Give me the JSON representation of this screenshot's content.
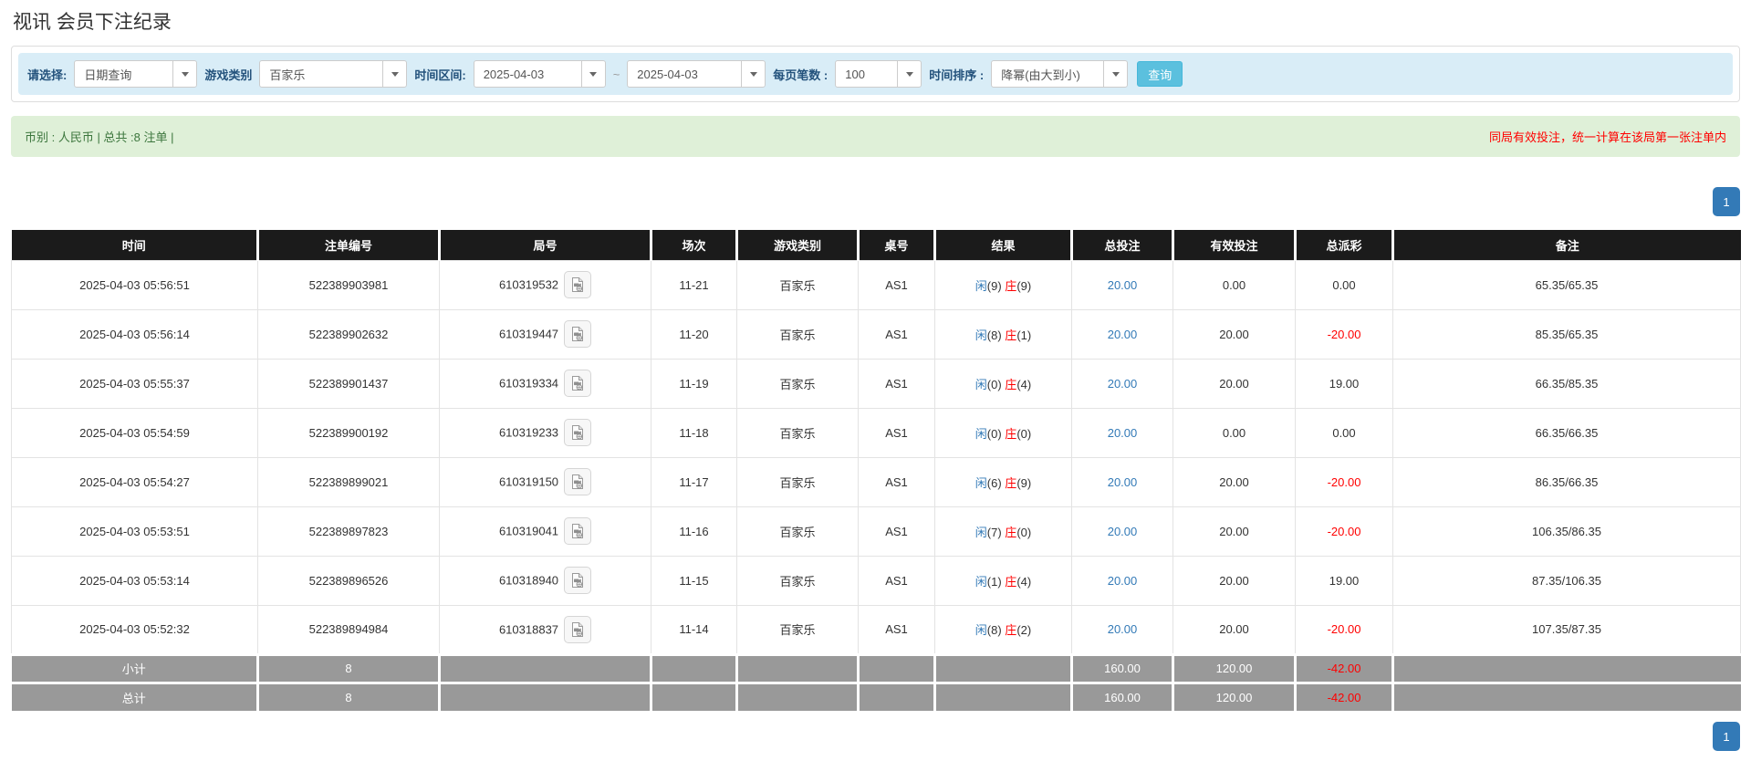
{
  "page_title": "视讯 会员下注纪录",
  "filters": {
    "select_label": "请选择:",
    "select_value": "日期查询",
    "game_type_label": "游戏类别",
    "game_type_value": "百家乐",
    "time_range_label": "时间区间:",
    "date_from": "2025-04-03",
    "date_separator": "~",
    "date_to": "2025-04-03",
    "page_size_label": "每页笔数 :",
    "page_size_value": "100",
    "sort_label": "时间排序 :",
    "sort_value": "降幂(由大到小)",
    "search_button": "查询"
  },
  "summary_bar": {
    "left_text": "币别 : 人民币 | 总共 :8 注单 |",
    "right_text": "同局有效投注，统一计算在该局第一张注单内"
  },
  "pagination": {
    "page": "1"
  },
  "colors": {
    "accent_button": "#5bc0de",
    "link_blue": "#337ab7",
    "player_blue": "#337ab7",
    "banker_red": "#ff0000",
    "negative_red": "#ff0000",
    "header_bg": "#1b1b1b",
    "totals_bg": "#999999",
    "alert_bg": "#dff0d8",
    "filter_bg": "#d9edf7"
  },
  "table": {
    "headers": [
      "时间",
      "注单编号",
      "局号",
      "场次",
      "游戏类别",
      "桌号",
      "结果",
      "总投注",
      "有效投注",
      "总派彩",
      "备注"
    ],
    "rows": [
      {
        "time": "2025-04-03 05:56:51",
        "bet_id": "522389903981",
        "round_id": "610319532",
        "session": "11-21",
        "game": "百家乐",
        "table_no": "AS1",
        "player_label": "闲",
        "player_value": "(9)",
        "banker_label": "庄",
        "banker_value": "(9)",
        "total_bet": "20.00",
        "valid_bet": "0.00",
        "payout": "0.00",
        "payout_negative": false,
        "remark": "65.35/65.35"
      },
      {
        "time": "2025-04-03 05:56:14",
        "bet_id": "522389902632",
        "round_id": "610319447",
        "session": "11-20",
        "game": "百家乐",
        "table_no": "AS1",
        "player_label": "闲",
        "player_value": "(8)",
        "banker_label": "庄",
        "banker_value": "(1)",
        "total_bet": "20.00",
        "valid_bet": "20.00",
        "payout": "-20.00",
        "payout_negative": true,
        "remark": "85.35/65.35"
      },
      {
        "time": "2025-04-03 05:55:37",
        "bet_id": "522389901437",
        "round_id": "610319334",
        "session": "11-19",
        "game": "百家乐",
        "table_no": "AS1",
        "player_label": "闲",
        "player_value": "(0)",
        "banker_label": "庄",
        "banker_value": "(4)",
        "total_bet": "20.00",
        "valid_bet": "20.00",
        "payout": "19.00",
        "payout_negative": false,
        "remark": "66.35/85.35"
      },
      {
        "time": "2025-04-03 05:54:59",
        "bet_id": "522389900192",
        "round_id": "610319233",
        "session": "11-18",
        "game": "百家乐",
        "table_no": "AS1",
        "player_label": "闲",
        "player_value": "(0)",
        "banker_label": "庄",
        "banker_value": "(0)",
        "total_bet": "20.00",
        "valid_bet": "0.00",
        "payout": "0.00",
        "payout_negative": false,
        "remark": "66.35/66.35"
      },
      {
        "time": "2025-04-03 05:54:27",
        "bet_id": "522389899021",
        "round_id": "610319150",
        "session": "11-17",
        "game": "百家乐",
        "table_no": "AS1",
        "player_label": "闲",
        "player_value": "(6)",
        "banker_label": "庄",
        "banker_value": "(9)",
        "total_bet": "20.00",
        "valid_bet": "20.00",
        "payout": "-20.00",
        "payout_negative": true,
        "remark": "86.35/66.35"
      },
      {
        "time": "2025-04-03 05:53:51",
        "bet_id": "522389897823",
        "round_id": "610319041",
        "session": "11-16",
        "game": "百家乐",
        "table_no": "AS1",
        "player_label": "闲",
        "player_value": "(7)",
        "banker_label": "庄",
        "banker_value": "(0)",
        "total_bet": "20.00",
        "valid_bet": "20.00",
        "payout": "-20.00",
        "payout_negative": true,
        "remark": "106.35/86.35"
      },
      {
        "time": "2025-04-03 05:53:14",
        "bet_id": "522389896526",
        "round_id": "610318940",
        "session": "11-15",
        "game": "百家乐",
        "table_no": "AS1",
        "player_label": "闲",
        "player_value": "(1)",
        "banker_label": "庄",
        "banker_value": "(4)",
        "total_bet": "20.00",
        "valid_bet": "20.00",
        "payout": "19.00",
        "payout_negative": false,
        "remark": "87.35/106.35"
      },
      {
        "time": "2025-04-03 05:52:32",
        "bet_id": "522389894984",
        "round_id": "610318837",
        "session": "11-14",
        "game": "百家乐",
        "table_no": "AS1",
        "player_label": "闲",
        "player_value": "(8)",
        "banker_label": "庄",
        "banker_value": "(2)",
        "total_bet": "20.00",
        "valid_bet": "20.00",
        "payout": "-20.00",
        "payout_negative": true,
        "remark": "107.35/87.35"
      }
    ],
    "subtotal": {
      "label": "小计",
      "count": "8",
      "total_bet": "160.00",
      "valid_bet": "120.00",
      "payout": "-42.00",
      "payout_negative": true
    },
    "total": {
      "label": "总计",
      "count": "8",
      "total_bet": "160.00",
      "valid_bet": "120.00",
      "payout": "-42.00",
      "payout_negative": true
    }
  }
}
